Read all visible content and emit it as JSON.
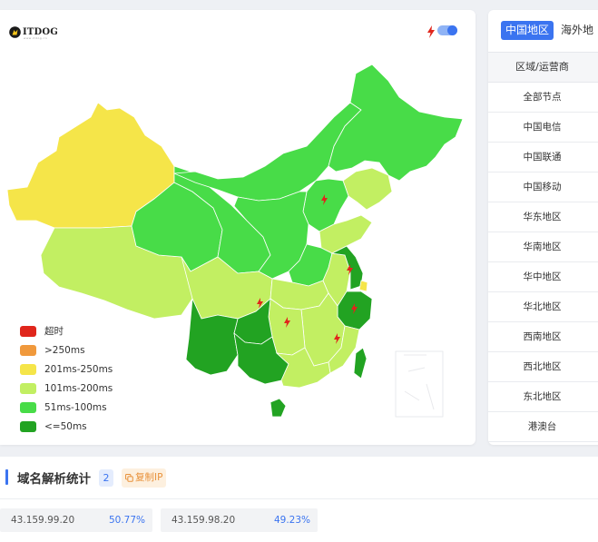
{
  "logo": {
    "name": "ITDOG",
    "tagline": "www.itdog.cn"
  },
  "colors": {
    "accent": "#3b74f0",
    "timeout": "#e0261c",
    "gt250": "#f0993c",
    "ms201_250": "#f5e549",
    "ms101_200": "#c2ef62",
    "ms51_100": "#48dc48",
    "le50": "#22a322"
  },
  "legend": [
    {
      "label": "超时",
      "color": "#e0261c"
    },
    {
      "label": ">250ms",
      "color": "#f0993c"
    },
    {
      "label": "201ms-250ms",
      "color": "#f5e549"
    },
    {
      "label": "101ms-200ms",
      "color": "#c2ef62"
    },
    {
      "label": "51ms-100ms",
      "color": "#48dc48"
    },
    {
      "label": "<=50ms",
      "color": "#22a322"
    }
  ],
  "side": {
    "tab_active": "中国地区",
    "tab_other": "海外地",
    "header": "区域/运营商",
    "rows": [
      "全部节点",
      "中国电信",
      "中国联通",
      "中国移动",
      "华东地区",
      "华南地区",
      "华中地区",
      "华北地区",
      "西南地区",
      "西北地区",
      "东北地区",
      "港澳台"
    ]
  },
  "stats": {
    "title": "域名解析统计",
    "count": "2",
    "copy_label": "复制IP",
    "ips": [
      {
        "ip": "43.159.99.20",
        "percent": "50.77%"
      },
      {
        "ip": "43.159.98.20",
        "percent": "49.23%"
      }
    ]
  }
}
